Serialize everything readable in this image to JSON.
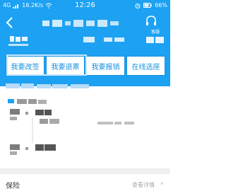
{
  "status_bar": {
    "network": "4G",
    "speed": "16.2K/s",
    "time": "12:26",
    "battery": "66%",
    "icons": [
      "signal-icon",
      "wifi-icon",
      "alarm-icon",
      "battery-icon"
    ]
  },
  "nav": {
    "back_icon": "back-arrow-icon",
    "headset_icon": "headset-icon",
    "service_label": "客服"
  },
  "actions": [
    {
      "label": "我要改签"
    },
    {
      "label": "我要退票"
    },
    {
      "label": "我要报销"
    },
    {
      "label": "在线选座"
    }
  ],
  "insurance": {
    "label": "保险",
    "detail": "查看详情"
  },
  "colors": {
    "brand_blue": "#1da1f2",
    "button_blue": "#1891e0",
    "highlight": "#c9e8fb"
  }
}
